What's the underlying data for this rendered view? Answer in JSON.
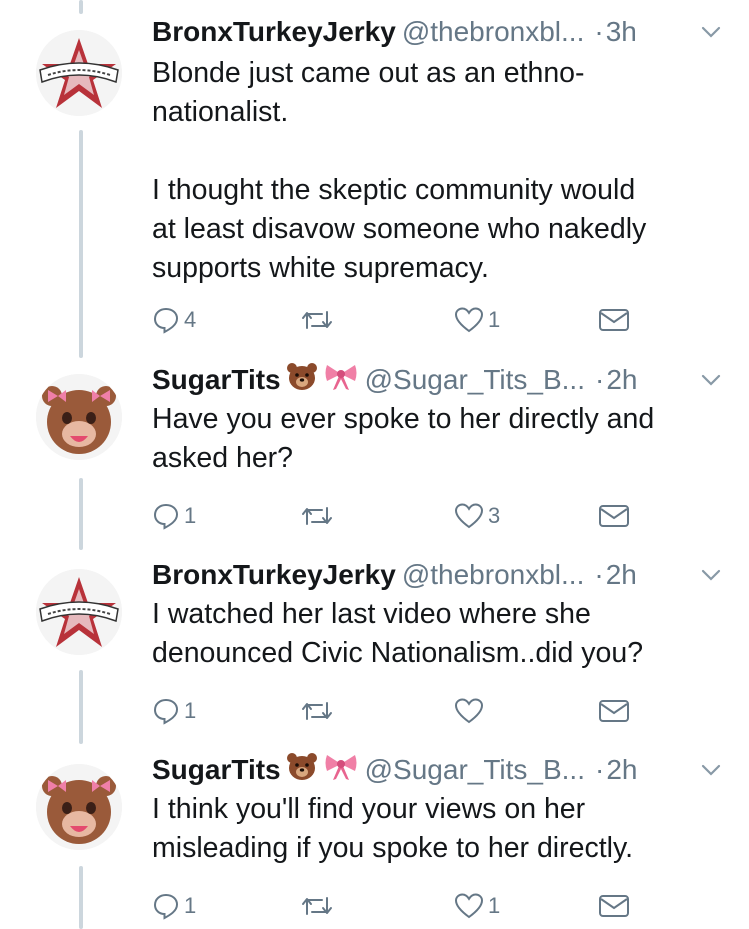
{
  "tweets": [
    {
      "name": "BronxTurkeyJerky",
      "handle": "@thebronxbl...",
      "time": "3h",
      "text": "Blonde just came out as an ethno-\nnationalist.\n\nI thought the skeptic community would\nat least disavow someone who nakedly\nsupports white supremacy.",
      "replies": "4",
      "retweets": "",
      "likes": "1",
      "avatar": "star-banner-icon"
    },
    {
      "name": "SugarTits",
      "handle": "@Sugar_Tits_B...",
      "time": "2h",
      "text": "Have you ever spoke to her directly and\nasked her?",
      "replies": "1",
      "retweets": "",
      "likes": "3",
      "avatar": "bear-avatar-icon"
    },
    {
      "name": "BronxTurkeyJerky",
      "handle": "@thebronxbl...",
      "time": "2h",
      "text": "I watched her last video where she\ndenounced Civic Nationalism..did you?",
      "replies": "1",
      "retweets": "",
      "likes": "",
      "avatar": "star-banner-icon"
    },
    {
      "name": "SugarTits",
      "handle": "@Sugar_Tits_B...",
      "time": "2h",
      "text": "I think you'll find your views on her\nmisleading if you spoke to her directly.",
      "replies": "1",
      "retweets": "",
      "likes": "1",
      "avatar": "bear-avatar-icon"
    }
  ],
  "colors": {
    "text": "#14171a",
    "muted": "#657786",
    "thread": "#ccd6dd",
    "bow": "#e8648f",
    "bear": "#8b4a2b"
  }
}
